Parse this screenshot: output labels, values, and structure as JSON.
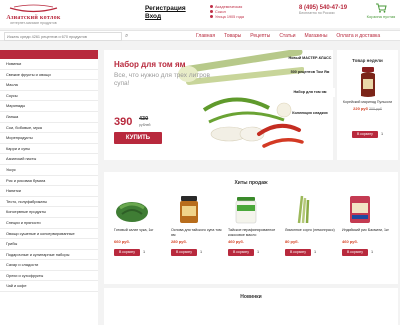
{
  "header": {
    "logo_title": "Азиатский котлок",
    "logo_subtitle": "интернет-магазин продуктов",
    "register": "Регистрация",
    "login": "Вход",
    "metro": [
      "Академическая",
      "Сокол",
      "Улица 1905 года"
    ],
    "phone": "8 (495) 540-47-19",
    "phone_note": "Бесплатно по России",
    "cart": "Корзина пустая",
    "colors": {
      "brand": "#b8293d",
      "cart": "#4a9a3a"
    }
  },
  "navbar": {
    "search_placeholder": "Искать среди 4261 рецептов и 670 продуктов",
    "links": [
      "Главная",
      "Товары",
      "Рецепты",
      "Статьи",
      "Магазины",
      "Оплата и доставка"
    ]
  },
  "sidebar": {
    "items": [
      "Новинки",
      "Свежие фрукты и овощи",
      "Масла",
      "Соусы",
      "Маринады",
      "Лапша",
      "Сои, бобовые, мука",
      "Морепродукты",
      "Карри и супы",
      "Азиатский пасты",
      "Уксус",
      "Рис и рисовая бумага",
      "Напитки",
      "Тесто, полуфабрикаты",
      "Консервные продукты",
      "Специи и пряности",
      "Овощи сушеные и консервированные",
      "Грибы",
      "Подарочные и кулинарные наборы",
      "Сахар и сладости",
      "Орехи и сухофрукты",
      "Чай и кофе"
    ]
  },
  "banner": {
    "title": "Набор для том ям",
    "subtitle": "Все, что нужно для трех литров супа!",
    "price": "390",
    "old_price": "430",
    "unit": "рублей",
    "buy": "КУПИТЬ",
    "right": [
      "Новый МАСТЕР-КЛАСС",
      "500 рецептов Том Ям",
      "Набор для том ям",
      "Коллекция сладких"
    ]
  },
  "week": {
    "title": "Товар недели",
    "name": "Корейский маринад Пулькоги",
    "price": "220 руб",
    "old_price": "300 руб",
    "button": "В корзину",
    "qty": "1"
  },
  "hits": {
    "title": "Хиты продаж",
    "items": [
      {
        "name": "Готовый салат чука, 1кг",
        "price": "660 руб.",
        "button": "В корзину",
        "qty": "1"
      },
      {
        "name": "Основа для тайского супа том ям",
        "price": "280 руб.",
        "button": "В корзину",
        "qty": "1"
      },
      {
        "name": "Тайское нерафинированное кокосовое масло",
        "price": "460 руб.",
        "button": "В корзину",
        "qty": "1"
      },
      {
        "name": "Лимонное сорго (лемонграсс)",
        "price": "80 руб.",
        "button": "В корзину",
        "qty": "1"
      },
      {
        "name": "Индийский рис Басмати, 1кг",
        "price": "460 руб.",
        "button": "В корзину",
        "qty": "1"
      }
    ]
  },
  "novelties": {
    "title": "Новинки"
  }
}
